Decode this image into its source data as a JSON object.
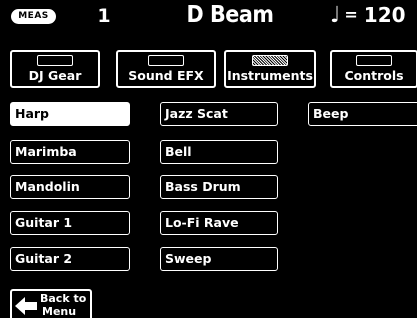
{
  "header": {
    "meas_label": "MEAS",
    "measure": "1",
    "title": "D Beam",
    "tempo_symbol": "♩",
    "tempo_eq": "=",
    "tempo_value": "120"
  },
  "tabs": [
    {
      "label": "DJ Gear",
      "active": false
    },
    {
      "label": "Sound EFX",
      "active": false
    },
    {
      "label": "Instruments",
      "active": true
    },
    {
      "label": "Controls",
      "active": false
    }
  ],
  "instruments": {
    "col1": [
      "Harp",
      "Marimba",
      "Mandolin",
      "Guitar 1",
      "Guitar 2"
    ],
    "col2": [
      "Jazz Scat",
      "Bell",
      "Bass Drum",
      "Lo-Fi Rave",
      "Sweep"
    ],
    "col3": [
      "Beep"
    ],
    "selected": "Harp"
  },
  "back_button": {
    "line1": "Back to",
    "line2": "Menu"
  }
}
